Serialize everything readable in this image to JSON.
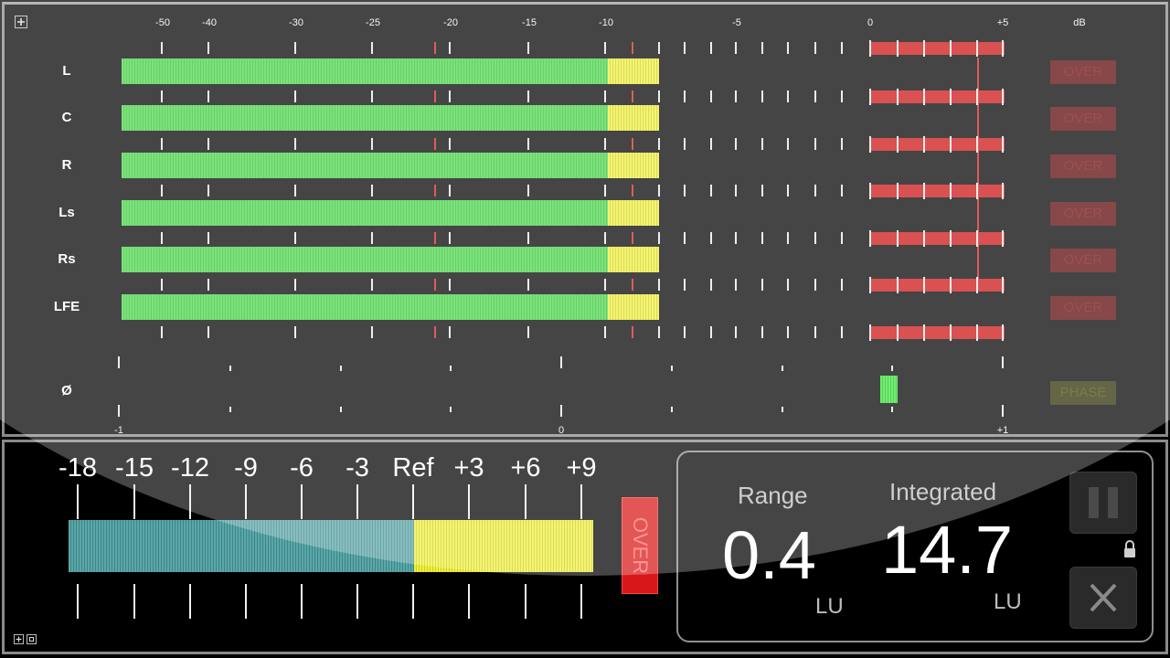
{
  "top_meter": {
    "db_scale_labels": [
      "-50",
      "-40",
      "-30",
      "-25",
      "-20",
      "-15",
      "-10",
      "-5",
      "0",
      "+5",
      "dB"
    ],
    "channels": [
      {
        "label": "L",
        "over_label": "OVER"
      },
      {
        "label": "C",
        "over_label": "OVER"
      },
      {
        "label": "R",
        "over_label": "OVER"
      },
      {
        "label": "Ls",
        "over_label": "OVER"
      },
      {
        "label": "Rs",
        "over_label": "OVER"
      },
      {
        "label": "LFE",
        "over_label": "OVER"
      }
    ],
    "phase": {
      "label": "Ø",
      "indicator_label": "PHASE",
      "scale_labels": [
        "-1",
        "0",
        "+1"
      ]
    }
  },
  "loudness_meter": {
    "scale_labels": [
      "-18",
      "-15",
      "-12",
      "-9",
      "-6",
      "-3",
      "Ref",
      "+3",
      "+6",
      "+9"
    ],
    "over_label": "OVER"
  },
  "readout": {
    "range": {
      "label": "Range",
      "value": "0.4",
      "unit": "LU"
    },
    "integrated": {
      "label": "Integrated",
      "value": "14.7",
      "unit": "LU"
    }
  },
  "controls": {
    "pause_icon": "pause-icon",
    "close_icon": "close-icon",
    "lock_icon": "lock-icon"
  },
  "colors": {
    "level_green": "#4ad84a",
    "level_yellow": "#f0f040",
    "peak_red": "#cc1111",
    "loudness_blue": "#4f9a9c"
  }
}
